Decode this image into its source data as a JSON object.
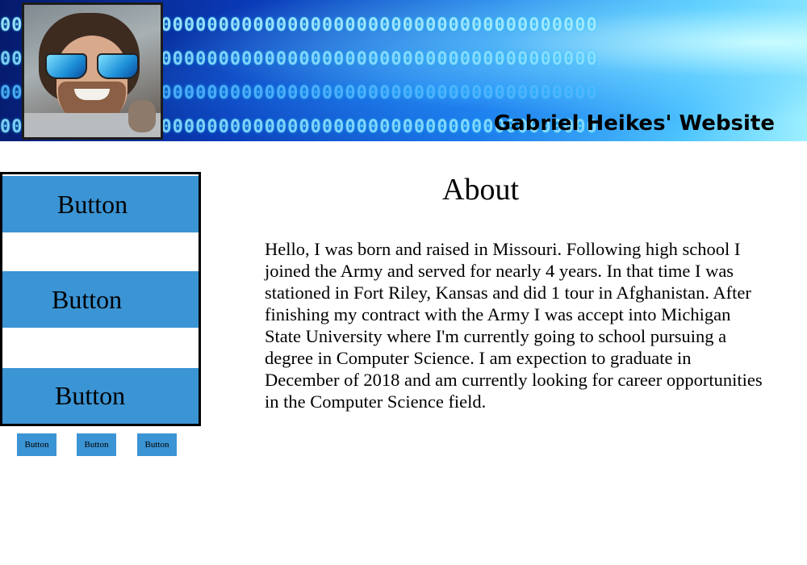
{
  "header": {
    "site_title": "Gabriel Heikes' Website",
    "profile_photo_alt": "profile photo",
    "banner_background": "blue binary digits"
  },
  "sidebar": {
    "buttons": [
      {
        "label": "Button"
      },
      {
        "label": "Button"
      },
      {
        "label": "Button"
      }
    ]
  },
  "small_buttons": [
    {
      "label": "Button"
    },
    {
      "label": "Button"
    },
    {
      "label": "Button"
    }
  ],
  "main": {
    "heading": "About",
    "body": "Hello, I was born and raised in Missouri. Following high school I joined the Army and served for nearly 4 years. In that time I was stationed in Fort Riley, Kansas and did 1 tour in Afghanistan. After finishing my contract with the Army I was accept into Michigan State University where I'm currently going to school pursuing a degree in Computer Science. I am expection to graduate in December of 2018 and am currently looking for career opportunities in the Computer Science field."
  },
  "colors": {
    "button_blue": "#3b94d4",
    "banner_dark": "#061a6b",
    "banner_light": "#9ff0ff",
    "text": "#000000"
  }
}
